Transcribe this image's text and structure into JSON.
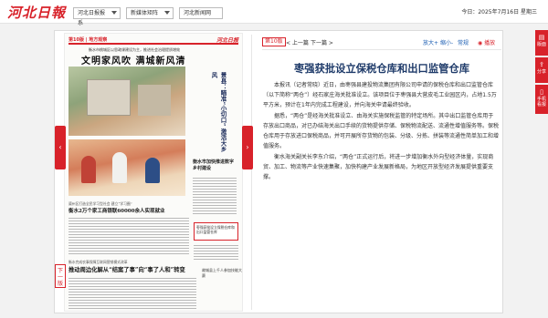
{
  "header": {
    "logo": "河北日報",
    "selects": [
      "河北日报报系",
      "新媒体矩阵",
      "河北新闻网"
    ],
    "date": "今日：2025年7月16日 星期三"
  },
  "nav": {
    "prev_arrow": "‹",
    "next_arrow": "›",
    "next_page": "下一版"
  },
  "paper": {
    "page_no": "第10版",
    "page_name": "地方观察",
    "masthead": "河北日报",
    "sub_headline": "衡水市桃城区以思政课建设为主，推进社会治理提质增效",
    "main_headline": "文明家风吹  满城新风清",
    "vertical_headline": "景县：瞄准“小切口” 激活大乡风",
    "side_title": "衡水市加快推进数字乡村建设",
    "mid_small": "冀州区打造全民学习型社会 建立“学习圈”",
    "mid_headline": "衡水2万个家工商银联60000余人实现就业",
    "highlight": "枣强获批设立保税仓库和出口监管仓库",
    "bottom_small": "衡水完成农事保障互联网营销模式改革",
    "bottom_headline": "推动周边化解从“结案了事”向“事了人和”转变",
    "right_bottom": "故城县上千人参加技能大赛"
  },
  "toolbar": {
    "page_badge": "第10版",
    "prev": "< 上一篇",
    "next": "下一篇 >",
    "zoom_in": "放大+",
    "zoom_out": "缩小-",
    "normal": "常规",
    "play": "播放"
  },
  "article": {
    "title": "枣强获批设立保税仓库和出口监管仓库",
    "paragraphs": [
      "本报讯（记者常晓）近日，由枣强县建投物流集团有限公司申请的保税仓库和出口监管仓库（以下简称“两仓”）经石家庄海关批准设立。该项目位于枣强县大营皮毛工业园区内，占地1.5万平方米，预计在1年内完成工程建设，并向海关申请最终验收。",
      "据悉，“两仓”是经海关批准设立、由海关实施保税监管的特定场所。其中出口监管仓库用于存放出口商品，对已办结海关出口手续的货物提供存储、保税物流配送、流通性增值服务等。保税仓库用于存放进口保税商品，并可开展所存货物的包装、分级、分拣、拼装等流通性简单加工和增值服务。",
      "衡水海关副关长李东介绍，“两仓”正式运行后，将进一步增加衡水外向型经济体量，实现商贸、加工、物流等产业快速集聚，加快构建产业发展新格局，为地区开放型经济发展提供重要支撑。"
    ]
  },
  "float_menu": {
    "items": [
      {
        "label": "版面",
        "icon": "▤"
      },
      {
        "label": "分享",
        "icon": "⇪"
      },
      {
        "label": "手机看报",
        "icon": "▯"
      }
    ]
  },
  "colors": {
    "brand_red": "#d8222a",
    "title_blue": "#1f3b6a",
    "link_blue": "#1d5fb3"
  }
}
